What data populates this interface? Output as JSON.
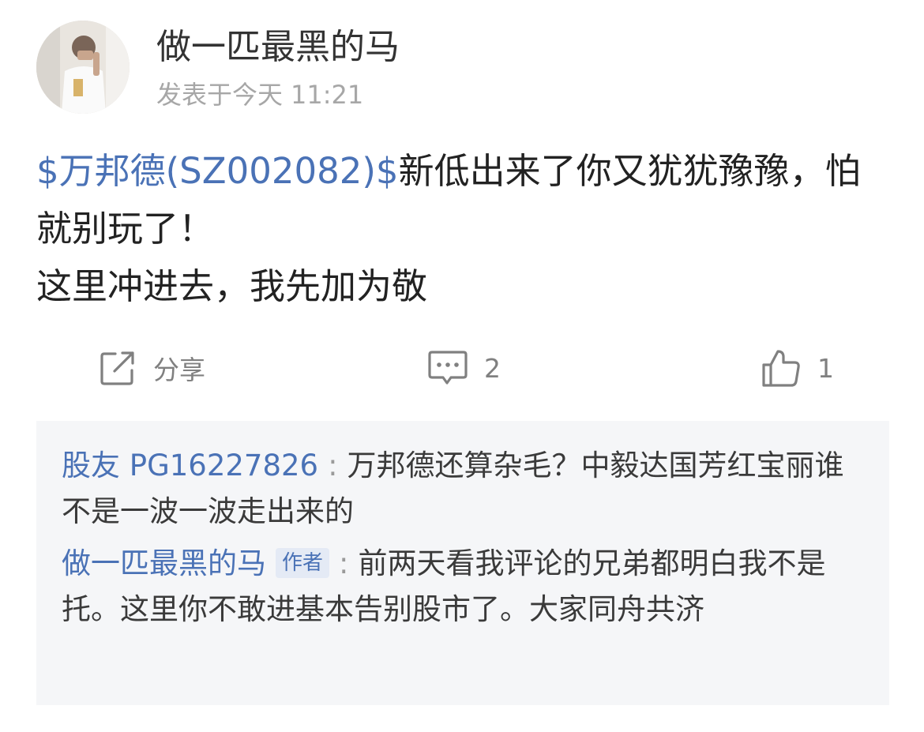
{
  "post": {
    "author_name": "做一匹最黑的马",
    "time_prefix": "发表于今天",
    "time": "11:21",
    "stock_tag": "$万邦德(SZ002082)$",
    "content_line1_rest": "新低出来了你又犹犹豫豫，怕就别玩了！",
    "content_line2": "这里冲进去，我先加为敬"
  },
  "actions": {
    "share_label": "分享",
    "comment_count": "2",
    "like_count": "1"
  },
  "comments": [
    {
      "user": "股友 PG16227826",
      "separator": ":",
      "badge": "",
      "text": "万邦德还算杂毛？中毅达国芳红宝丽谁不是一波一波走出来的"
    },
    {
      "user": "做一匹最黑的马",
      "separator": ":",
      "badge": "作者",
      "text": "前两天看我评论的兄弟都明白我不是托。这里你不敢进基本告别股市了。大家同舟共济"
    }
  ],
  "colors": {
    "link": "#4a72b6",
    "body_text": "#222222",
    "muted_text": "#a7a7a7",
    "comment_bg": "#f5f6f8"
  },
  "icons": {
    "share": "share-icon",
    "comment": "comment-icon",
    "like": "thumbs-up-icon"
  }
}
